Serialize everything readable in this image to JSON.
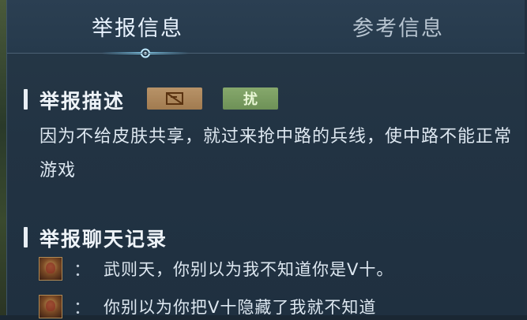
{
  "tabs": {
    "report_info": "举报信息",
    "reference_info": "参考信息"
  },
  "report_description": {
    "title": "举报描述",
    "tags": [
      {
        "label": "",
        "icon": "censored-icon",
        "color": "#a88157"
      },
      {
        "label": "扰",
        "color": "#7b9c62"
      }
    ],
    "text": "因为不给皮肤共享，就过来抢中路的兵线，使中路不能正常游戏"
  },
  "chat_log": {
    "title": "举报聊天记录",
    "messages": [
      {
        "separator": "：",
        "text": "武则天，你别以为我不知道你是V十。"
      },
      {
        "separator": "：",
        "text": "你别以为你把V十隐藏了我就不知道"
      }
    ]
  }
}
